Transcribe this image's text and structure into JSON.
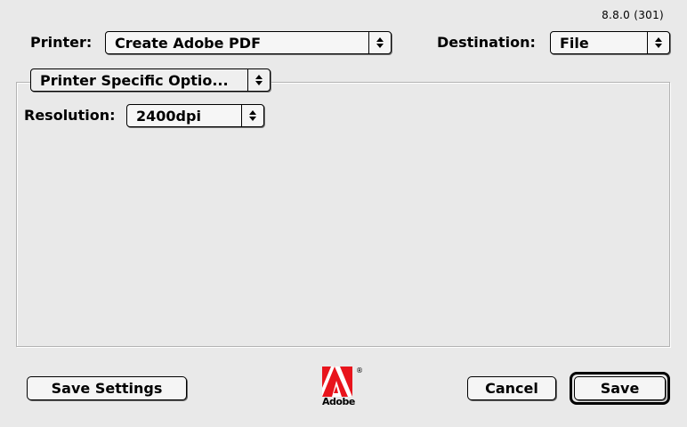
{
  "version": "8.8.0 (301)",
  "printer": {
    "label": "Printer:",
    "value": "Create Adobe PDF"
  },
  "destination": {
    "label": "Destination:",
    "value": "File"
  },
  "panel_menu": {
    "value": "Printer Specific Optio..."
  },
  "resolution": {
    "label": "Resolution:",
    "value": "2400dpi"
  },
  "buttons": {
    "save_settings": "Save Settings",
    "cancel": "Cancel",
    "save": "Save"
  },
  "logo": {
    "text": "Adobe",
    "registered": "®"
  },
  "colors": {
    "background": "#e9e9e9",
    "logo_red": "#e8141c"
  }
}
